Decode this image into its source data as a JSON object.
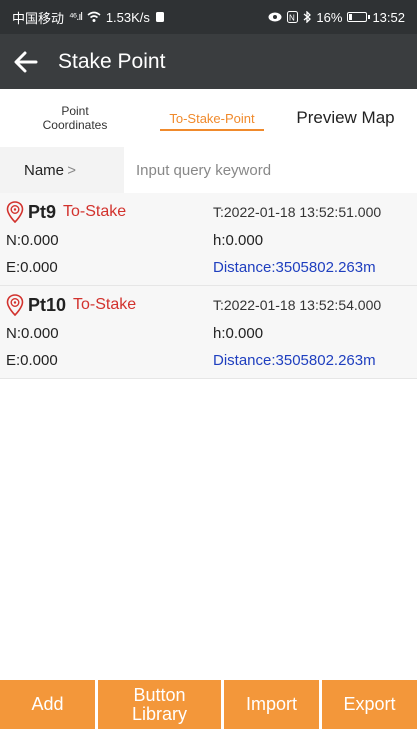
{
  "status_bar": {
    "carrier": "中国移动",
    "network": "⁴⁶.ıl",
    "speed": "1.53K/s",
    "battery_percent": "16%",
    "battery_level": 0.16,
    "time": "13:52"
  },
  "app_bar": {
    "title": "Stake Point"
  },
  "tabs": [
    {
      "label": "Point Coordinates"
    },
    {
      "label": "To-Stake-Point",
      "active": true
    },
    {
      "label": "Preview Map"
    }
  ],
  "search": {
    "label": "Name",
    "placeholder": "Input query keyword"
  },
  "points": [
    {
      "name": "Pt9",
      "status": "To-Stake",
      "time": "T:2022-01-18 13:52:51.000",
      "n": "N:0.000",
      "h": "h:0.000",
      "e": "E:0.000",
      "distance": "Distance:3505802.263m"
    },
    {
      "name": "Pt10",
      "status": "To-Stake",
      "time": "T:2022-01-18 13:52:54.000",
      "n": "N:0.000",
      "h": "h:0.000",
      "e": "E:0.000",
      "distance": "Distance:3505802.263m"
    }
  ],
  "buttons": {
    "add": "Add",
    "button_library": "Button Library",
    "import": "Import",
    "export": "Export"
  },
  "colors": {
    "accent": "#f08a2c",
    "button": "#f3973a",
    "status_red": "#d2322d",
    "distance_blue": "#1f3fbf",
    "app_bar": "#3a3d3f"
  }
}
